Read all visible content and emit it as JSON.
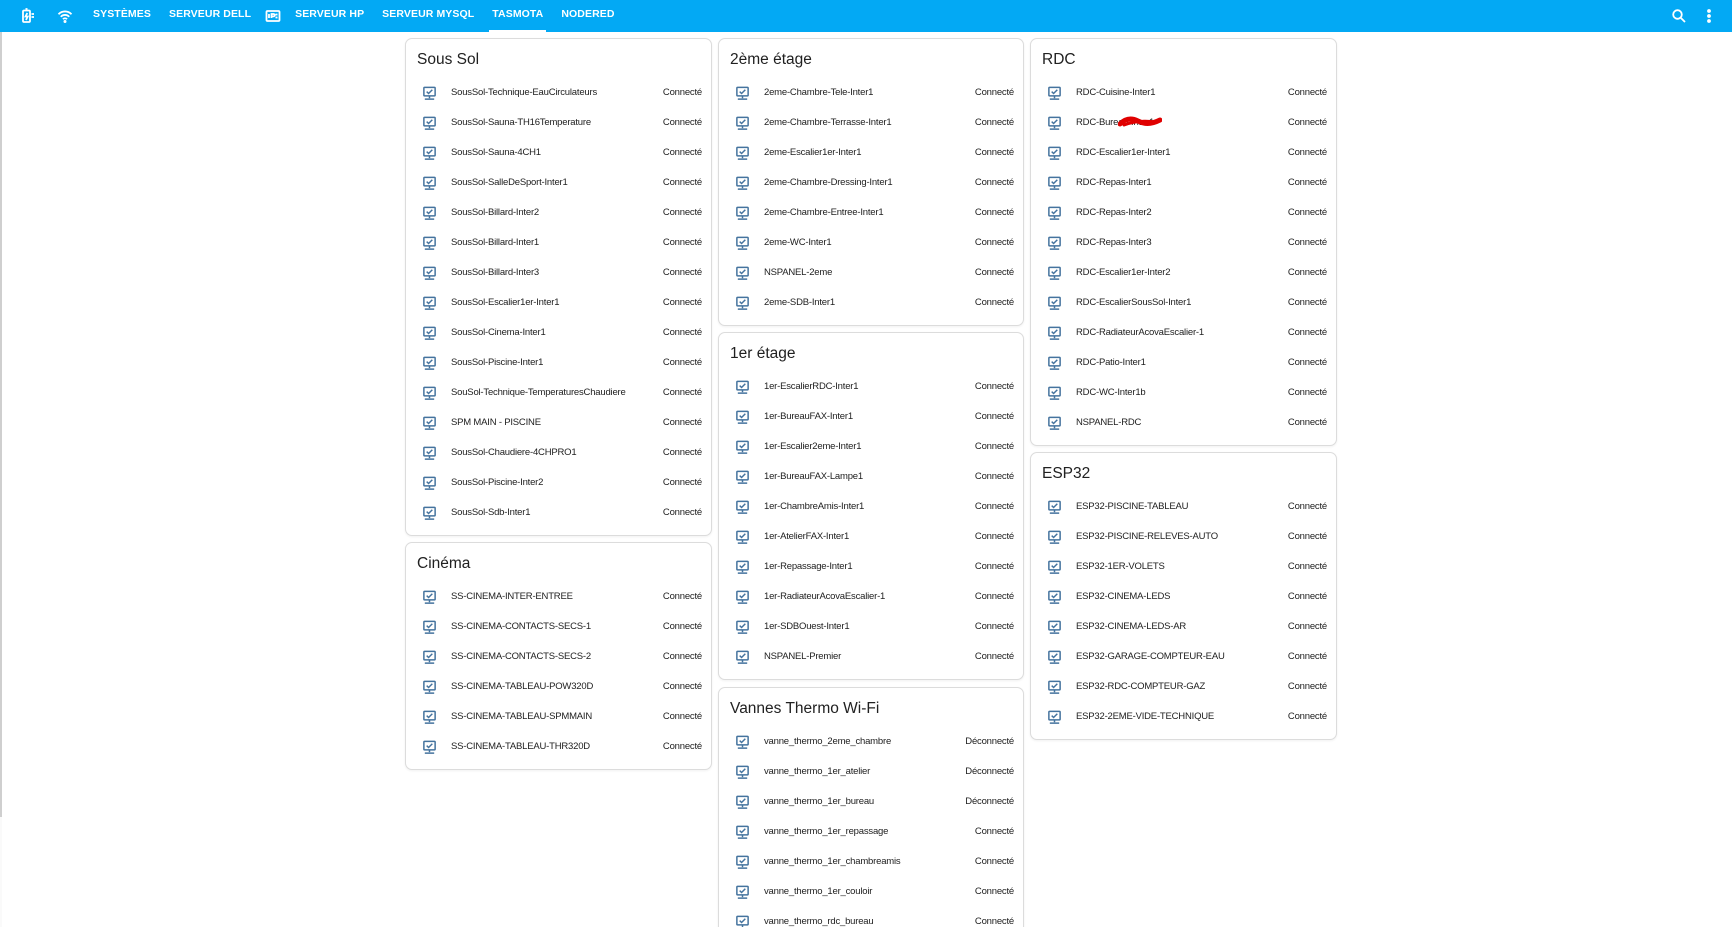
{
  "colors": {
    "header": "#03a9f4",
    "icon": "#44739e",
    "scribble": "#e00000"
  },
  "header": {
    "tabs": [
      {
        "label": "SYSTÈMES"
      },
      {
        "label": "SERVEUR DELL"
      },
      {
        "label": "SERVEUR HP"
      },
      {
        "label": "SERVEUR MYSQL"
      },
      {
        "label": "TASMOTA",
        "active": true
      },
      {
        "label": "NODERED"
      }
    ],
    "icons": [
      "battery-charging-icon",
      "wifi-icon",
      "ip-card-icon",
      "search-icon",
      "more-vertical-icon"
    ]
  },
  "cards": {
    "soussol": {
      "title": "Sous Sol",
      "rows": [
        {
          "name": "SousSol-Technique-EauCirculateurs",
          "state": "Connecté"
        },
        {
          "name": "SousSol-Sauna-TH16Temperature",
          "state": "Connecté"
        },
        {
          "name": "SousSol-Sauna-4CH1",
          "state": "Connecté"
        },
        {
          "name": "SousSol-SalleDeSport-Inter1",
          "state": "Connecté"
        },
        {
          "name": "SousSol-Billard-Inter2",
          "state": "Connecté"
        },
        {
          "name": "SousSol-Billard-Inter1",
          "state": "Connecté"
        },
        {
          "name": "SousSol-Billard-Inter3",
          "state": "Connecté"
        },
        {
          "name": "SousSol-Escalier1er-Inter1",
          "state": "Connecté"
        },
        {
          "name": "SousSol-Cinema-Inter1",
          "state": "Connecté"
        },
        {
          "name": "SousSol-Piscine-Inter1",
          "state": "Connecté"
        },
        {
          "name": "SouSol-Technique-TemperaturesChaudiere",
          "state": "Connecté"
        },
        {
          "name": "SPM MAIN - PISCINE",
          "state": "Connecté"
        },
        {
          "name": "SousSol-Chaudiere-4CHPRO1",
          "state": "Connecté"
        },
        {
          "name": "SousSol-Piscine-Inter2",
          "state": "Connecté"
        },
        {
          "name": "SousSol-Sdb-Inter1",
          "state": "Connecté"
        }
      ]
    },
    "cinema": {
      "title": "Cinéma",
      "rows": [
        {
          "name": "SS-CINEMA-INTER-ENTREE",
          "state": "Connecté"
        },
        {
          "name": "SS-CINEMA-CONTACTS-SECS-1",
          "state": "Connecté"
        },
        {
          "name": "SS-CINEMA-CONTACTS-SECS-2",
          "state": "Connecté"
        },
        {
          "name": "SS-CINEMA-TABLEAU-POW320D",
          "state": "Connecté"
        },
        {
          "name": "SS-CINEMA-TABLEAU-SPMMAIN",
          "state": "Connecté"
        },
        {
          "name": "SS-CINEMA-TABLEAU-THR320D",
          "state": "Connecté"
        }
      ]
    },
    "etage2": {
      "title": "2ème étage",
      "rows": [
        {
          "name": "2eme-Chambre-Tele-Inter1",
          "state": "Connecté"
        },
        {
          "name": "2eme-Chambre-Terrasse-Inter1",
          "state": "Connecté"
        },
        {
          "name": "2eme-Escalier1er-Inter1",
          "state": "Connecté"
        },
        {
          "name": "2eme-Chambre-Dressing-Inter1",
          "state": "Connecté"
        },
        {
          "name": "2eme-Chambre-Entree-Inter1",
          "state": "Connecté"
        },
        {
          "name": "2eme-WC-Inter1",
          "state": "Connecté"
        },
        {
          "name": "NSPANEL-2eme",
          "state": "Connecté"
        },
        {
          "name": "2eme-SDB-Inter1",
          "state": "Connecté"
        }
      ]
    },
    "etage1": {
      "title": "1er étage",
      "rows": [
        {
          "name": "1er-EscalierRDC-Inter1",
          "state": "Connecté"
        },
        {
          "name": "1er-BureauFAX-Inter1",
          "state": "Connecté"
        },
        {
          "name": "1er-Escalier2eme-Inter1",
          "state": "Connecté"
        },
        {
          "name": "1er-BureauFAX-Lampe1",
          "state": "Connecté"
        },
        {
          "name": "1er-ChambreAmis-Inter1",
          "state": "Connecté"
        },
        {
          "name": "1er-AtelierFAX-Inter1",
          "state": "Connecté"
        },
        {
          "name": "1er-Repassage-Inter1",
          "state": "Connecté"
        },
        {
          "name": "1er-RadiateurAcovaEscalier-1",
          "state": "Connecté"
        },
        {
          "name": "1er-SDBOuest-Inter1",
          "state": "Connecté"
        },
        {
          "name": "NSPANEL-Premier",
          "state": "Connecté"
        }
      ]
    },
    "vannes": {
      "title": "Vannes Thermo Wi-Fi",
      "rows": [
        {
          "name": "vanne_thermo_2eme_chambre",
          "state": "Déconnecté"
        },
        {
          "name": "vanne_thermo_1er_atelier",
          "state": "Déconnecté"
        },
        {
          "name": "vanne_thermo_1er_bureau",
          "state": "Déconnecté"
        },
        {
          "name": "vanne_thermo_1er_repassage",
          "state": "Connecté"
        },
        {
          "name": "vanne_thermo_1er_chambreamis",
          "state": "Connecté"
        },
        {
          "name": "vanne_thermo_1er_couloir",
          "state": "Connecté"
        },
        {
          "name": "vanne_thermo_rdc_bureau",
          "state": "Connecté"
        }
      ]
    },
    "rdc": {
      "title": "RDC",
      "rows": [
        {
          "name": "RDC-Cuisine-Inter1",
          "state": "Connecté"
        },
        {
          "name": "RDC-Bureau",
          "name2": "Inter1",
          "state": "Connecté"
        },
        {
          "name": "RDC-Escalier1er-Inter1",
          "state": "Connecté"
        },
        {
          "name": "RDC-Repas-Inter1",
          "state": "Connecté"
        },
        {
          "name": "RDC-Repas-Inter2",
          "state": "Connecté"
        },
        {
          "name": "RDC-Repas-Inter3",
          "state": "Connecté"
        },
        {
          "name": "RDC-Escalier1er-Inter2",
          "state": "Connecté"
        },
        {
          "name": "RDC-EscalierSousSol-Inter1",
          "state": "Connecté"
        },
        {
          "name": "RDC-RadiateurAcovaEscalier-1",
          "state": "Connecté"
        },
        {
          "name": "RDC-Patio-Inter1",
          "state": "Connecté"
        },
        {
          "name": "RDC-WC-Inter1b",
          "state": "Connecté"
        },
        {
          "name": "NSPANEL-RDC",
          "state": "Connecté"
        }
      ]
    },
    "esp32": {
      "title": "ESP32",
      "rows": [
        {
          "name": "ESP32-PISCINE-TABLEAU",
          "state": "Connecté"
        },
        {
          "name": "ESP32-PISCINE-RELEVES-AUTO",
          "state": "Connecté"
        },
        {
          "name": "ESP32-1ER-VOLETS",
          "state": "Connecté"
        },
        {
          "name": "ESP32-CINEMA-LEDS",
          "state": "Connecté"
        },
        {
          "name": "ESP32-CINEMA-LEDS-AR",
          "state": "Connecté"
        },
        {
          "name": "ESP32-GARAGE-COMPTEUR-EAU",
          "state": "Connecté"
        },
        {
          "name": "ESP32-RDC-COMPTEUR-GAZ",
          "state": "Connecté"
        },
        {
          "name": "ESP32-2EME-VIDE-TECHNIQUE",
          "state": "Connecté"
        }
      ]
    }
  }
}
